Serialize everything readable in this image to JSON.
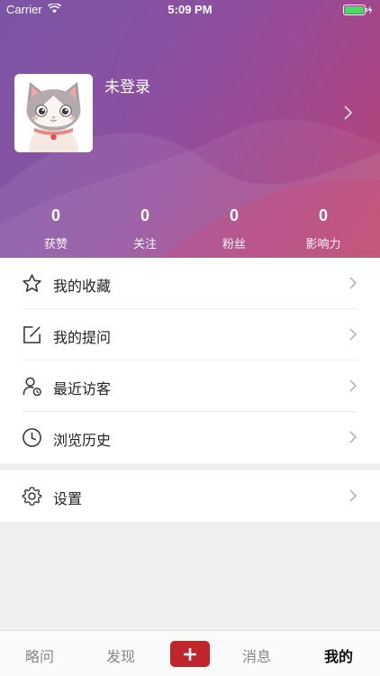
{
  "status_bar": {
    "carrier": "Carrier",
    "time": "5:09 PM",
    "icons": [
      "wifi-icon",
      "battery-icon",
      "charging-icon"
    ]
  },
  "profile": {
    "name": "未登录",
    "avatar": "cat-avatar"
  },
  "stats": [
    {
      "value": "0",
      "label": "获赞"
    },
    {
      "value": "0",
      "label": "关注"
    },
    {
      "value": "0",
      "label": "粉丝"
    },
    {
      "value": "0",
      "label": "影响力"
    }
  ],
  "menu": [
    {
      "label": "我的收藏",
      "icon": "star-icon"
    },
    {
      "label": "我的提问",
      "icon": "edit-icon"
    },
    {
      "label": "最近访客",
      "icon": "visitor-icon"
    },
    {
      "label": "浏览历史",
      "icon": "clock-icon"
    }
  ],
  "settings": {
    "label": "设置",
    "icon": "gear-icon"
  },
  "tabbar": {
    "tabs": [
      {
        "label": "略问"
      },
      {
        "label": "发现"
      },
      {
        "label": "消息"
      },
      {
        "label": "我的"
      }
    ],
    "add_icon": "plus-icon",
    "active_index": 3
  },
  "colors": {
    "accent": "#c0252b",
    "header_start": "#7b55a6",
    "header_end": "#b8476f"
  }
}
